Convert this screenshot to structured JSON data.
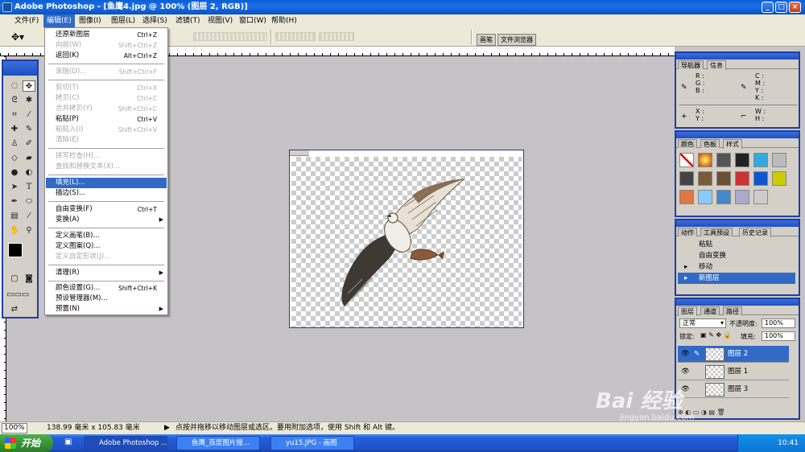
{
  "window": {
    "title": "Adobe Photoshop - [鱼鹰4.jpg @ 100% (图层 2, RGB)]"
  },
  "menubar": [
    {
      "label": "文件(F)"
    },
    {
      "label": "编辑(E)"
    },
    {
      "label": "图像(I)"
    },
    {
      "label": "图层(L)"
    },
    {
      "label": "选择(S)"
    },
    {
      "label": "滤镜(T)"
    },
    {
      "label": "视图(V)"
    },
    {
      "label": "窗口(W)"
    },
    {
      "label": "帮助(H)"
    }
  ],
  "palette_well": {
    "brushes": "画笔",
    "file_browser": "文件浏览器"
  },
  "edit_menu": {
    "undo": {
      "label": "还原新图层",
      "shortcut": "Ctrl+Z"
    },
    "step_forward": {
      "label": "向前(W)",
      "shortcut": "Shift+Ctrl+Z"
    },
    "step_backward": {
      "label": "返回(K)",
      "shortcut": "Alt+Ctrl+Z"
    },
    "fade": {
      "label": "渐隐(D)...",
      "shortcut": "Shift+Ctrl+F"
    },
    "cut": {
      "label": "剪切(T)",
      "shortcut": "Ctrl+X"
    },
    "copy": {
      "label": "拷贝(C)",
      "shortcut": "Ctrl+C"
    },
    "copy_merged": {
      "label": "合并拷贝(Y)",
      "shortcut": "Shift+Ctrl+C"
    },
    "paste": {
      "label": "粘贴(P)",
      "shortcut": "Ctrl+V"
    },
    "paste_into": {
      "label": "粘贴入(I)",
      "shortcut": "Shift+Ctrl+V"
    },
    "clear": {
      "label": "清除(E)"
    },
    "spell_check": {
      "label": "拼写检查(H)..."
    },
    "find_replace": {
      "label": "查找和替换文本(X)..."
    },
    "fill": {
      "label": "填充(L)..."
    },
    "stroke": {
      "label": "描边(S)..."
    },
    "free_transform": {
      "label": "自由变换(F)",
      "shortcut": "Ctrl+T"
    },
    "transform": {
      "label": "变换(A)"
    },
    "define_brush": {
      "label": "定义画笔(B)..."
    },
    "define_pattern": {
      "label": "定义图案(Q)..."
    },
    "define_shape": {
      "label": "定义自定形状(J)..."
    },
    "purge": {
      "label": "清理(R)"
    },
    "color_settings": {
      "label": "颜色设置(G)...",
      "shortcut": "Shift+Ctrl+K"
    },
    "preset_manager": {
      "label": "预设管理器(M)..."
    },
    "preferences": {
      "label": "预置(N)"
    }
  },
  "navigator_panel": {
    "tabs": [
      "导航器",
      "信息"
    ],
    "rgb": [
      "R :",
      "G :",
      "B :"
    ],
    "cmyk": [
      "C :",
      "M :",
      "Y :",
      "K :"
    ],
    "xy": [
      "X :",
      "Y :"
    ],
    "wh": [
      "W :",
      "H :"
    ]
  },
  "swatches_panel": {
    "tabs": [
      "颜色",
      "色板",
      "样式"
    ]
  },
  "history_panel": {
    "tabs": [
      "动作",
      "工具预设",
      "历史记录"
    ],
    "items": [
      "粘贴",
      "自由变换",
      "移动",
      "新图层"
    ]
  },
  "layers_panel": {
    "tabs": [
      "图层",
      "通道",
      "路径"
    ],
    "blend_mode": "正常",
    "opacity_label": "不透明度:",
    "opacity_value": "100%",
    "lock_label": "锁定:",
    "fill_label": "填充:",
    "fill_value": "100%",
    "layers": [
      "图层 2",
      "图层 1",
      "图层 3"
    ]
  },
  "statusbar": {
    "zoom": "100%",
    "doc_size": "138.99 毫米 x 105.83 毫米",
    "hint": "点按并拖移以移动图层或选区。要用附加选项，使用 Shift 和 Alt 键。"
  },
  "taskbar": {
    "start": "开始",
    "tasks": [
      "Adobe Photoshop ...",
      "鱼鹰_百度图片搜...",
      "yu15.JPG - 画图"
    ],
    "clock": "10:41"
  },
  "watermark": {
    "brand": "Bai 经验",
    "url": "jingyan.baidu.com"
  },
  "colors": {
    "titlebar": "#0a5fd6",
    "highlight": "#316ac5",
    "workspace": "#c6c3c6"
  }
}
